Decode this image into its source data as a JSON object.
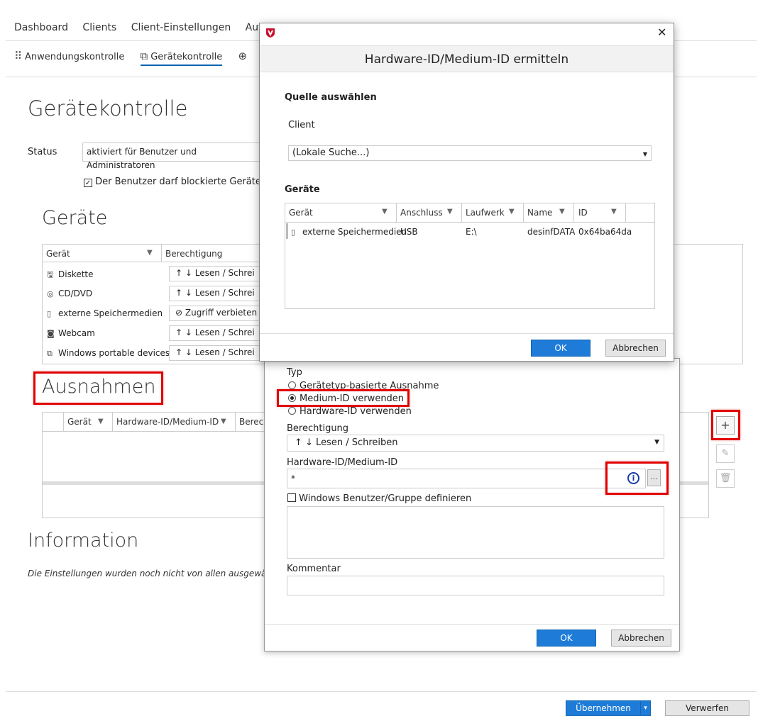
{
  "nav": {
    "items": [
      "Dashboard",
      "Clients",
      "Client-Einstellungen",
      "Aufträ"
    ]
  },
  "subtabs": [
    {
      "label": "Anwendungskontrolle",
      "icon": "app-control-icon"
    },
    {
      "label": "Gerätekontrolle",
      "icon": "device-control-icon",
      "active": true
    }
  ],
  "page": {
    "title": "Gerätekontrolle",
    "status_label": "Status",
    "status_value": "aktiviert für Benutzer und Administratoren",
    "checkbox_label": "Der Benutzer darf blockierte Geräte n"
  },
  "devices": {
    "title": "Geräte",
    "col_device": "Gerät",
    "col_permission": "Berechtigung",
    "rows": [
      {
        "name": "Diskette",
        "icon": "floppy-icon",
        "perm": "↑ ↓  Lesen / Schrei"
      },
      {
        "name": "CD/DVD",
        "icon": "disc-icon",
        "perm": "↑ ↓  Lesen / Schrei"
      },
      {
        "name": "externe Speichermedien",
        "icon": "usb-icon",
        "perm": "⊘  Zugriff verbieten"
      },
      {
        "name": "Webcam",
        "icon": "webcam-icon",
        "perm": "↑ ↓  Lesen / Schrei"
      },
      {
        "name": "Windows portable devices",
        "icon": "portable-device-icon",
        "perm": "↑ ↓  Lesen / Schrei"
      }
    ]
  },
  "exceptions": {
    "title": "Ausnahmen",
    "col_device": "Gerät",
    "col_hwid": "Hardware-ID/Medium-ID",
    "col_perm": "Berech"
  },
  "information": {
    "title": "Information",
    "text": "Die Einstellungen wurden noch nicht von allen ausgewä"
  },
  "footer": {
    "apply": "Übernehmen",
    "discard": "Verwerfen"
  },
  "dialog_exception": {
    "type_label": "Typ",
    "opt1": "Gerätetyp-basierte Ausnahme",
    "opt2": "Medium-ID verwenden",
    "opt3": "Hardware-ID verwenden",
    "perm_label": "Berechtigung",
    "perm_value": "↑ ↓   Lesen / Schreiben",
    "id_label": "Hardware-ID/Medium-ID",
    "id_value": "*",
    "browse": "...",
    "user_check": "Windows Benutzer/Gruppe definieren",
    "comment_label": "Kommentar",
    "ok": "OK",
    "cancel": "Abbrechen"
  },
  "dialog_hwid": {
    "title": "Hardware-ID/Medium-ID ermitteln",
    "source_heading": "Quelle auswählen",
    "client_label": "Client",
    "client_value": "(Lokale Suche...)",
    "devices_heading": "Geräte",
    "cols": [
      "Gerät",
      "Anschluss",
      "Laufwerk",
      "Name",
      "ID"
    ],
    "row": {
      "device": "externe Speichermedien",
      "port": "USB",
      "drive": "E:\\",
      "name": "desinfDATA",
      "id": "0x64ba64da"
    },
    "ok": "OK",
    "cancel": "Abbrechen"
  },
  "colors": {
    "accent": "#1e7cd8",
    "highlight": "#e00000"
  }
}
